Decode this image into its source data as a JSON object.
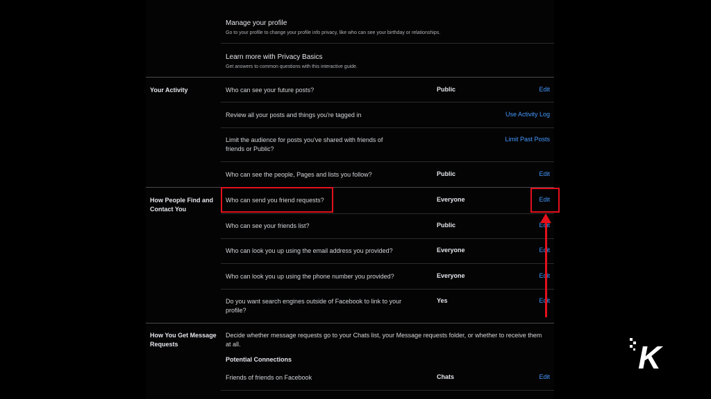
{
  "top_items": [
    {
      "title": "Manage your profile",
      "subtitle": "Go to your profile to change your profile info privacy, like who can see your birthday or relationships."
    },
    {
      "title": "Learn more with Privacy Basics",
      "subtitle": "Get answers to common questions with this interactive guide."
    }
  ],
  "sections": {
    "your_activity": {
      "title": "Your Activity",
      "rows": [
        {
          "question": "Who can see your future posts?",
          "value": "Public",
          "action": "Edit"
        },
        {
          "question": "Review all your posts and things you're tagged in",
          "value": "",
          "action": "Use Activity Log"
        },
        {
          "question": "Limit the audience for posts you've shared with friends of friends or Public?",
          "value": "",
          "action": "Limit Past Posts"
        },
        {
          "question": "Who can see the people, Pages and lists you follow?",
          "value": "Public",
          "action": "Edit"
        }
      ]
    },
    "find_contact": {
      "title": "How People Find and Contact You",
      "rows": [
        {
          "question": "Who can send you friend requests?",
          "value": "Everyone",
          "action": "Edit"
        },
        {
          "question": "Who can see your friends list?",
          "value": "Public",
          "action": "Edit"
        },
        {
          "question": "Who can look you up using the email address you provided?",
          "value": "Everyone",
          "action": "Edit"
        },
        {
          "question": "Who can look you up using the phone number you provided?",
          "value": "Everyone",
          "action": "Edit"
        },
        {
          "question": "Do you want search engines outside of Facebook to link to your profile?",
          "value": "Yes",
          "action": "Edit"
        }
      ]
    },
    "message_requests": {
      "title": "How You Get Message Requests",
      "description": "Decide whether message requests go to your Chats list, your Message requests folder, or whether to receive them at all.",
      "subheading": "Potential Connections",
      "rows": [
        {
          "question": "Friends of friends on Facebook",
          "value": "Chats",
          "action": "Edit"
        }
      ]
    }
  },
  "watermark": {
    "letter": "K"
  },
  "colors": {
    "background": "#000000",
    "link": "#4599ff",
    "highlight": "#e3101c"
  }
}
